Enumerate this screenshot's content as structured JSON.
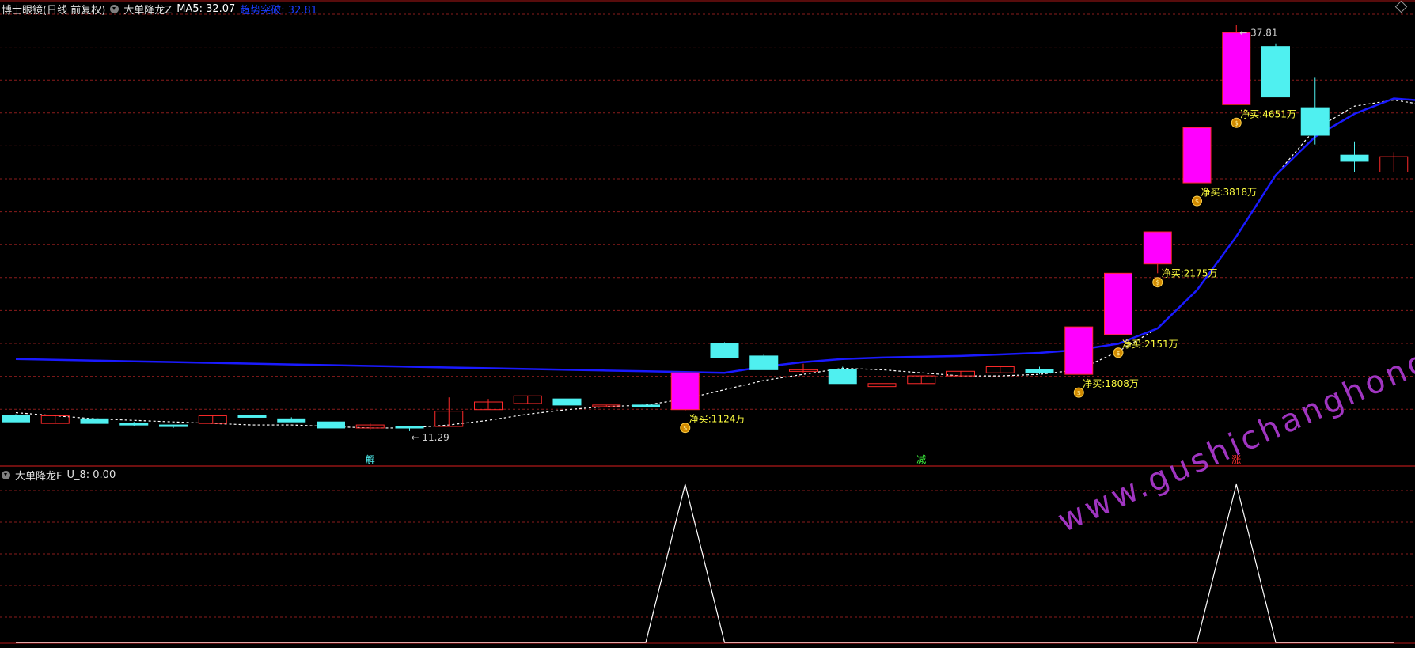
{
  "main_header": {
    "title": "博士眼镜(日线 前复权)",
    "indicator_name": "大单降龙Z",
    "ma_text": "MA5: 32.07",
    "ma_color": "#ffffff",
    "breakout_text": "趋势突破: 32.81",
    "breakout_color": "#1a3cff"
  },
  "sub_header": {
    "indicator_name": "大单降龙F",
    "value_text": "U_8: 0.00"
  },
  "colors": {
    "background": "#000000",
    "grid": "#8a1c1c",
    "divider": "#b01818",
    "up_candle": "#ff00ff",
    "up_border": "#ff2a2a",
    "down_candle": "#4ff0f0",
    "small_up_outline": "#ff2a2a",
    "blue_line": "#1a1aff",
    "ma_line": "#ffffff",
    "annotation": "#ffff40",
    "peak_line": "#ffffff",
    "watermark": "#b23bd6"
  },
  "chart_data": {
    "type": "candlestick",
    "y_range": [
      10.0,
      38.5
    ],
    "candles": [
      {
        "o": 12.3,
        "c": 11.9,
        "h": 12.4,
        "l": 11.9,
        "type": "down"
      },
      {
        "o": 11.8,
        "c": 12.3,
        "h": 12.3,
        "l": 11.8,
        "type": "up_outline"
      },
      {
        "o": 12.1,
        "c": 11.8,
        "h": 12.1,
        "l": 11.8,
        "type": "down"
      },
      {
        "o": 11.8,
        "c": 11.7,
        "h": 11.9,
        "l": 11.6,
        "type": "down"
      },
      {
        "o": 11.7,
        "c": 11.6,
        "h": 11.7,
        "l": 11.5,
        "type": "down"
      },
      {
        "o": 11.8,
        "c": 12.3,
        "h": 12.3,
        "l": 11.8,
        "type": "up_outline"
      },
      {
        "o": 12.3,
        "c": 12.3,
        "h": 12.4,
        "l": 12.2,
        "type": "down"
      },
      {
        "o": 12.1,
        "c": 11.9,
        "h": 12.2,
        "l": 11.9,
        "type": "down"
      },
      {
        "o": 11.9,
        "c": 11.5,
        "h": 11.9,
        "l": 11.5,
        "type": "down"
      },
      {
        "o": 11.5,
        "c": 11.7,
        "h": 11.8,
        "l": 11.4,
        "type": "up_outline"
      },
      {
        "o": 11.6,
        "c": 11.6,
        "h": 11.6,
        "l": 11.3,
        "type": "down"
      },
      {
        "o": 11.6,
        "c": 12.6,
        "h": 13.5,
        "l": 11.6,
        "type": "up_outline"
      },
      {
        "o": 12.7,
        "c": 13.2,
        "h": 13.4,
        "l": 12.7,
        "type": "up_outline"
      },
      {
        "o": 13.1,
        "c": 13.6,
        "h": 13.6,
        "l": 13.1,
        "type": "up_outline"
      },
      {
        "o": 13.4,
        "c": 13.0,
        "h": 13.6,
        "l": 13.0,
        "type": "down"
      },
      {
        "o": 12.9,
        "c": 13.0,
        "h": 13.0,
        "l": 12.9,
        "type": "up_outline"
      },
      {
        "o": 13.0,
        "c": 12.9,
        "h": 13.0,
        "l": 12.9,
        "type": "down"
      },
      {
        "o": 12.7,
        "c": 15.1,
        "h": 15.1,
        "l": 12.6,
        "type": "up"
      },
      {
        "o": 17.0,
        "c": 16.1,
        "h": 17.1,
        "l": 16.1,
        "type": "down"
      },
      {
        "o": 16.2,
        "c": 15.3,
        "h": 16.3,
        "l": 15.3,
        "type": "down"
      },
      {
        "o": 15.2,
        "c": 15.3,
        "h": 15.7,
        "l": 15.1,
        "type": "up_outline"
      },
      {
        "o": 15.3,
        "c": 14.4,
        "h": 15.5,
        "l": 14.4,
        "type": "down"
      },
      {
        "o": 14.2,
        "c": 14.4,
        "h": 14.6,
        "l": 14.2,
        "type": "up_outline"
      },
      {
        "o": 14.4,
        "c": 14.9,
        "h": 14.9,
        "l": 14.4,
        "type": "up_outline"
      },
      {
        "o": 14.9,
        "c": 15.2,
        "h": 15.2,
        "l": 14.9,
        "type": "up_outline"
      },
      {
        "o": 15.1,
        "c": 15.5,
        "h": 15.5,
        "l": 15.1,
        "type": "up_outline"
      },
      {
        "o": 15.3,
        "c": 15.1,
        "h": 15.5,
        "l": 15.0,
        "type": "down"
      },
      {
        "o": 15.0,
        "c": 18.1,
        "h": 18.1,
        "l": 15.0,
        "type": "up"
      },
      {
        "o": 17.6,
        "c": 21.6,
        "h": 21.6,
        "l": 17.6,
        "type": "up"
      },
      {
        "o": 22.2,
        "c": 24.3,
        "h": 24.3,
        "l": 21.6,
        "type": "up"
      },
      {
        "o": 27.5,
        "c": 31.1,
        "h": 31.1,
        "l": 27.5,
        "type": "up"
      },
      {
        "o": 32.6,
        "c": 37.3,
        "h": 37.8,
        "l": 32.6,
        "type": "up"
      },
      {
        "o": 36.4,
        "c": 33.1,
        "h": 36.6,
        "l": 33.1,
        "type": "down"
      },
      {
        "o": 32.4,
        "c": 30.6,
        "h": 34.4,
        "l": 30.0,
        "type": "down"
      },
      {
        "o": 29.3,
        "c": 28.9,
        "h": 30.2,
        "l": 28.2,
        "type": "down"
      },
      {
        "o": 28.2,
        "c": 29.2,
        "h": 29.5,
        "l": 28.2,
        "type": "up_outline"
      }
    ],
    "ma5": [
      12.5,
      12.3,
      12.1,
      12.0,
      11.9,
      11.8,
      11.7,
      11.7,
      11.6,
      11.5,
      11.5,
      11.7,
      12.0,
      12.4,
      12.7,
      12.9,
      13.0,
      13.4,
      14.0,
      14.6,
      15.0,
      15.4,
      15.3,
      15.1,
      14.9,
      14.9,
      15.0,
      15.3,
      16.5,
      18.0,
      20.5,
      24.0,
      28.0,
      31.0,
      32.5,
      32.9,
      32.5
    ],
    "trend": [
      16.0,
      15.95,
      15.9,
      15.85,
      15.8,
      15.75,
      15.7,
      15.65,
      15.6,
      15.55,
      15.5,
      15.45,
      15.4,
      15.35,
      15.3,
      15.25,
      15.2,
      15.15,
      15.1,
      15.5,
      15.8,
      16.0,
      16.1,
      16.15,
      16.2,
      16.3,
      16.4,
      16.6,
      17.0,
      18.0,
      20.5,
      24.0,
      28.0,
      30.5,
      32.0,
      33.0,
      32.81
    ],
    "labels": {
      "low": "11.29",
      "high": "37.81",
      "net_buys": [
        {
          "i": 17,
          "text": "净买:1124万"
        },
        {
          "i": 27,
          "text": "净买:1808万"
        },
        {
          "i": 28,
          "text": "净买:2151万"
        },
        {
          "i": 29,
          "text": "净买:2175万"
        },
        {
          "i": 30,
          "text": "净买:3818万"
        },
        {
          "i": 31,
          "text": "净买:4651万"
        }
      ],
      "markers": [
        {
          "i": 9,
          "text": "解",
          "color": "#4ff0f0"
        },
        {
          "i": 23,
          "text": "减",
          "color": "#40ff40"
        },
        {
          "i": 31,
          "text": "涨",
          "color": "#ff3030"
        }
      ]
    },
    "sub_indicator": {
      "name": "U_8",
      "values": [
        0,
        0,
        0,
        0,
        0,
        0,
        0,
        0,
        0,
        0,
        0,
        0,
        0,
        0,
        0,
        0,
        0,
        1,
        0,
        0,
        0,
        0,
        0,
        0,
        0,
        0,
        0,
        0,
        0,
        0,
        0,
        1,
        0,
        0,
        0,
        0
      ]
    }
  },
  "watermark_text": "www.gushichanghong.com"
}
